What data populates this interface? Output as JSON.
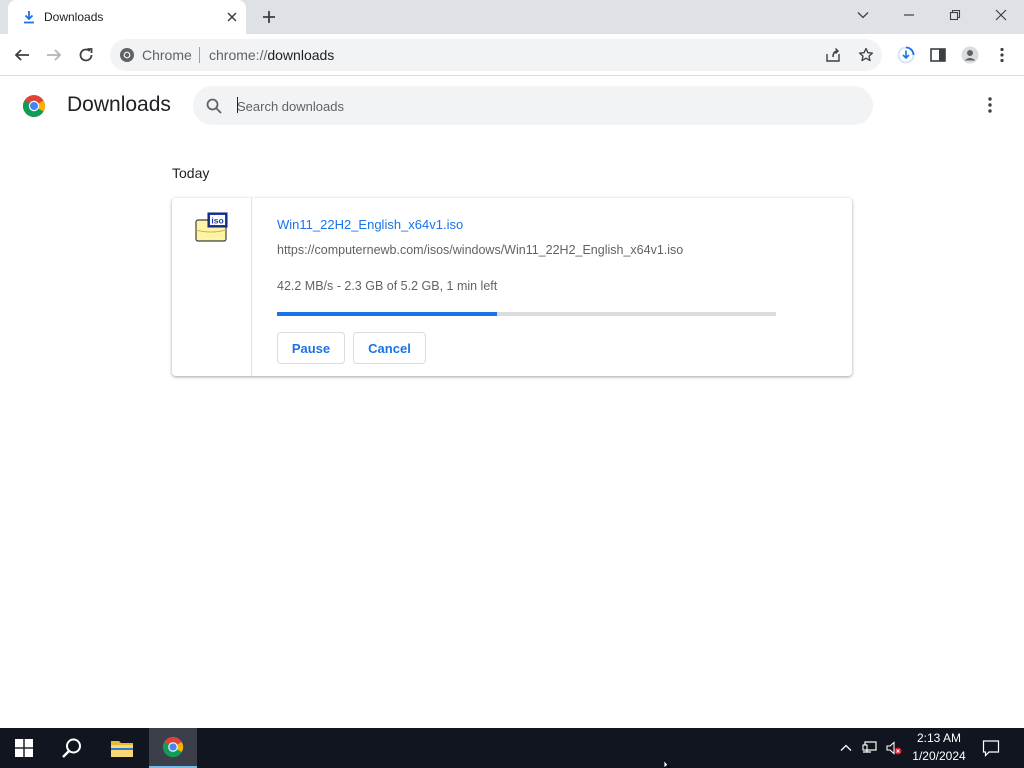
{
  "browser": {
    "tab_title": "Downloads",
    "omnibox": {
      "chip": "Chrome",
      "url_scheme": "chrome://",
      "url_host": "downloads"
    }
  },
  "page": {
    "title": "Downloads",
    "search_placeholder": "Search downloads",
    "section": "Today"
  },
  "download": {
    "file_name": "Win11_22H2_English_x64v1.iso",
    "url": "https://computernewb.com/isos/windows/Win11_22H2_English_x64v1.iso",
    "status": "42.2 MB/s - 2.3 GB of 5.2 GB, 1 min left",
    "progress_percent": 44,
    "pause_label": "Pause",
    "cancel_label": "Cancel",
    "file_icon_text": "iso"
  },
  "taskbar": {
    "time": "2:13 AM",
    "date": "1/20/2024"
  },
  "colors": {
    "accent": "#1a73e8",
    "tab_strip": "#dee1e6",
    "taskbar": "#10151f"
  }
}
